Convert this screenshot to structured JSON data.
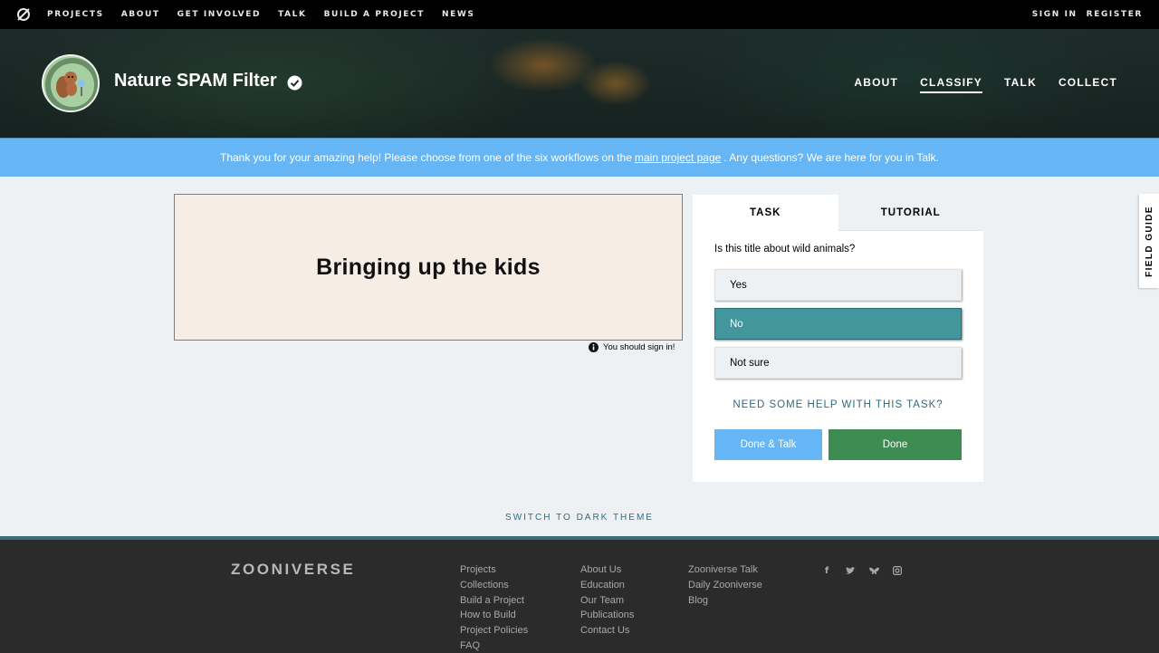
{
  "topnav": {
    "links": [
      "PROJECTS",
      "ABOUT",
      "GET INVOLVED",
      "TALK",
      "BUILD A PROJECT",
      "NEWS"
    ],
    "sign_in": "SIGN IN",
    "register": "REGISTER"
  },
  "project": {
    "title": "Nature SPAM Filter",
    "nav": [
      "ABOUT",
      "CLASSIFY",
      "TALK",
      "COLLECT"
    ],
    "active_nav": "CLASSIFY"
  },
  "banner": {
    "text_before": "Thank you for your amazing help! Please choose from one of the six workflows on the",
    "link": "main project page",
    "text_after": ". Any questions? We are here for you in Talk."
  },
  "subject": {
    "text": "Bringing up the kids",
    "signin_note": "You should sign in!"
  },
  "task": {
    "tabs": [
      "TASK",
      "TUTORIAL"
    ],
    "active_tab": "TASK",
    "question": "Is this title about wild animals?",
    "answers": [
      "Yes",
      "No",
      "Not sure"
    ],
    "selected_answer": "No",
    "help_link": "NEED SOME HELP WITH THIS TASK?",
    "done_talk": "Done & Talk",
    "done": "Done"
  },
  "field_guide": "FIELD GUIDE",
  "theme_switch": "SWITCH TO DARK THEME",
  "footer": {
    "logo": "ZOONIVERSE",
    "col1": [
      "Projects",
      "Collections",
      "Build a Project",
      "How to Build",
      "Project Policies",
      "FAQ"
    ],
    "col2": [
      "About Us",
      "Education",
      "Our Team",
      "Publications",
      "Contact Us"
    ],
    "col3": [
      "Zooniverse Talk",
      "Daily Zooniverse",
      "Blog"
    ],
    "social_icons": [
      "facebook-icon",
      "twitter-icon",
      "bluesky-icon",
      "instagram-icon"
    ]
  },
  "colors": {
    "banner": "#66b6f6",
    "selected_answer": "#43969c",
    "done_button": "#3f8c52",
    "done_talk_button": "#66b6f6",
    "footer_bg": "#2b2b2b"
  }
}
